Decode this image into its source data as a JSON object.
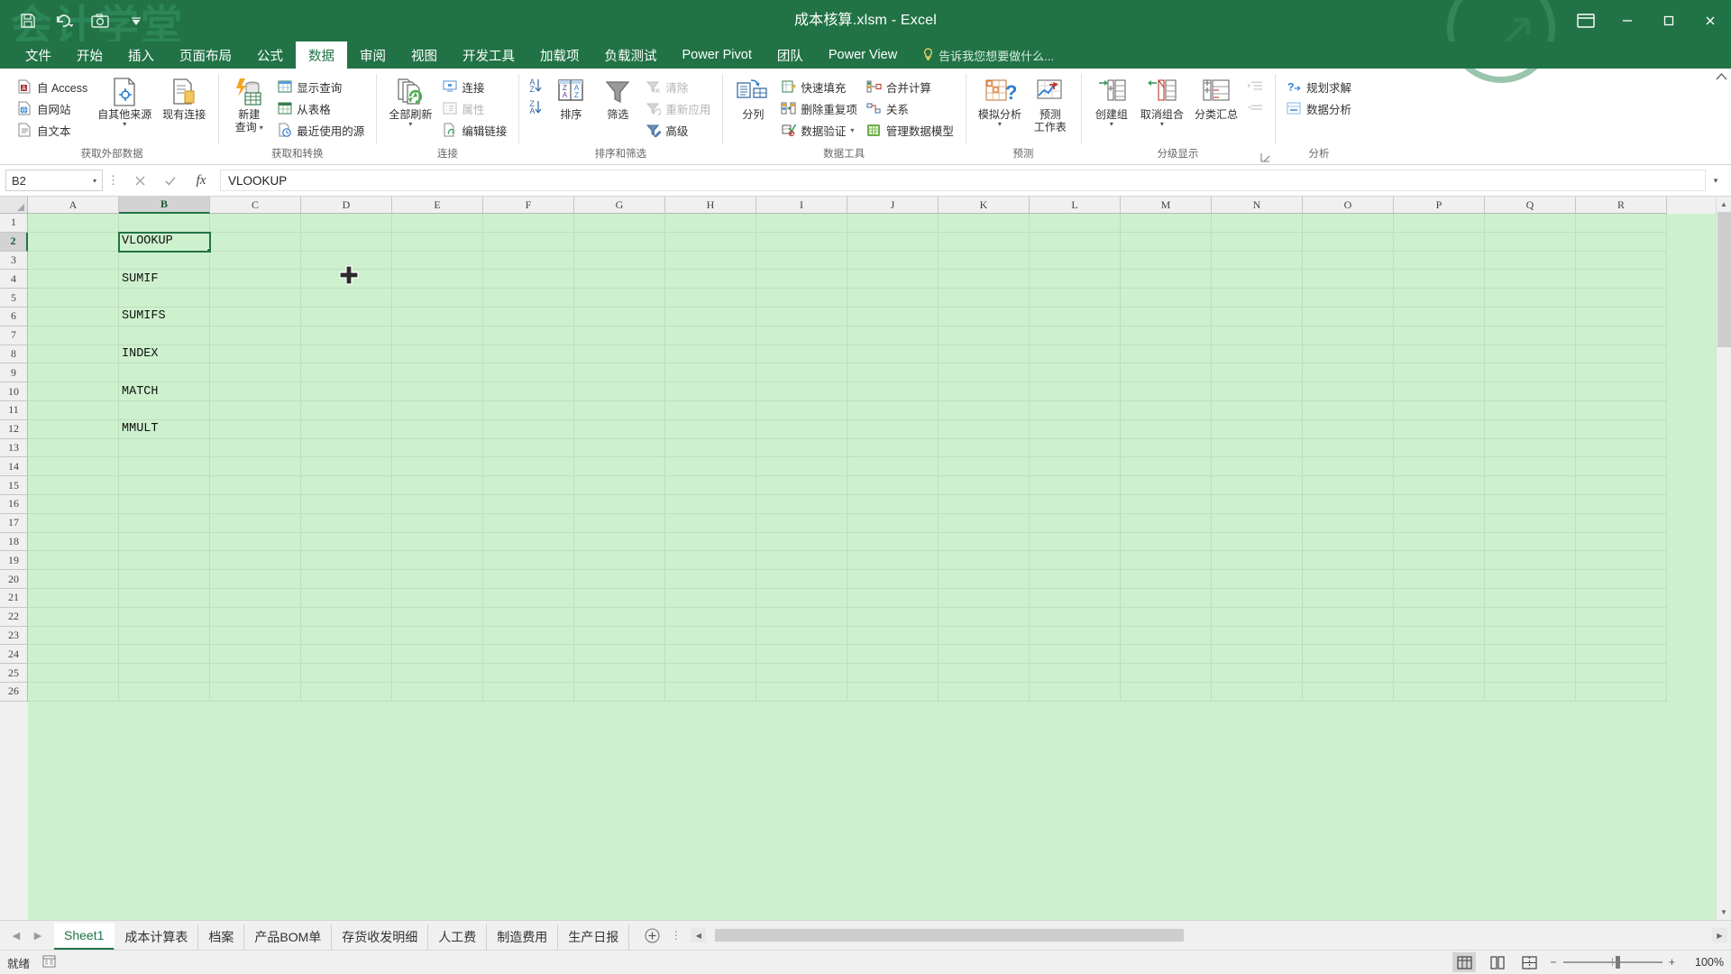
{
  "window": {
    "title": "成本核算.xlsm - Excel",
    "watermark": "会计学堂",
    "minimize": "–",
    "maximize": "□",
    "close": "✕",
    "ribbon_display_options": "ribbon-display-options"
  },
  "quick_access": [
    {
      "name": "save-icon",
      "label": "保存"
    },
    {
      "name": "undo-icon",
      "label": "撤销"
    },
    {
      "name": "screenshot-icon",
      "label": "屏幕截图"
    },
    {
      "name": "customize-qat-icon",
      "label": "自定义快速访问工具栏"
    }
  ],
  "ribbon_tabs": [
    {
      "label": "文件",
      "active": false
    },
    {
      "label": "开始",
      "active": false
    },
    {
      "label": "插入",
      "active": false
    },
    {
      "label": "页面布局",
      "active": false
    },
    {
      "label": "公式",
      "active": false
    },
    {
      "label": "数据",
      "active": true
    },
    {
      "label": "审阅",
      "active": false
    },
    {
      "label": "视图",
      "active": false
    },
    {
      "label": "开发工具",
      "active": false
    },
    {
      "label": "加载项",
      "active": false
    },
    {
      "label": "负载测试",
      "active": false
    },
    {
      "label": "Power Pivot",
      "active": false
    },
    {
      "label": "团队",
      "active": false
    },
    {
      "label": "Power View",
      "active": false
    }
  ],
  "tell_me": "告诉我您想要做什么...",
  "ribbon_groups": {
    "external_data": {
      "label": "获取外部数据",
      "small_items": [
        {
          "label": "自 Access",
          "icon": "access-icon",
          "disabled": false
        },
        {
          "label": "自网站",
          "icon": "web-icon",
          "disabled": false
        },
        {
          "label": "自文本",
          "icon": "text-file-icon",
          "disabled": false
        }
      ],
      "big_items": [
        {
          "label": "自其他来源",
          "icon": "other-sources-icon",
          "has_caret": true
        },
        {
          "label": "现有连接",
          "icon": "existing-connection-icon",
          "has_caret": false
        }
      ]
    },
    "get_transform": {
      "label": "获取和转换",
      "big_items": [
        {
          "label_line1": "新建",
          "label_line2": "查询",
          "icon": "new-query-icon",
          "has_caret": true
        }
      ],
      "small_items": [
        {
          "label": "显示查询",
          "icon": "show-queries-icon",
          "disabled": false
        },
        {
          "label": "从表格",
          "icon": "from-table-icon",
          "disabled": false
        },
        {
          "label": "最近使用的源",
          "icon": "recent-sources-icon",
          "disabled": false
        }
      ]
    },
    "connections": {
      "label": "连接",
      "big_items": [
        {
          "label": "全部刷新",
          "icon": "refresh-all-icon",
          "has_caret": true
        }
      ],
      "small_items": [
        {
          "label": "连接",
          "icon": "connections-icon",
          "disabled": false
        },
        {
          "label": "属性",
          "icon": "properties-icon",
          "disabled": true
        },
        {
          "label": "编辑链接",
          "icon": "edit-links-icon",
          "disabled": false
        }
      ]
    },
    "sort_filter": {
      "label": "排序和筛选",
      "sort_asc": "A-Z-sort-icon",
      "sort_desc": "Z-A-sort-icon",
      "big_items": [
        {
          "label": "排序",
          "icon": "sort-icon",
          "has_caret": false
        },
        {
          "label": "筛选",
          "icon": "filter-icon",
          "has_caret": false
        }
      ],
      "small_items": [
        {
          "label": "清除",
          "icon": "clear-filter-icon",
          "disabled": true
        },
        {
          "label": "重新应用",
          "icon": "reapply-filter-icon",
          "disabled": true
        },
        {
          "label": "高级",
          "icon": "advanced-filter-icon",
          "disabled": false
        }
      ]
    },
    "data_tools": {
      "label": "数据工具",
      "big_items": [
        {
          "label": "分列",
          "icon": "text-to-columns-icon",
          "has_caret": false
        }
      ],
      "small_items_col1": [
        {
          "label": "快速填充",
          "icon": "flash-fill-icon",
          "disabled": false
        },
        {
          "label": "删除重复项",
          "icon": "remove-duplicates-icon",
          "disabled": false
        },
        {
          "label": "数据验证",
          "icon": "data-validation-icon",
          "disabled": false,
          "has_caret": true
        }
      ],
      "small_items_col2": [
        {
          "label": "合并计算",
          "icon": "consolidate-icon",
          "disabled": false
        },
        {
          "label": "关系",
          "icon": "relationships-icon",
          "disabled": false
        },
        {
          "label": "管理数据模型",
          "icon": "manage-data-model-icon",
          "disabled": false
        }
      ]
    },
    "forecast": {
      "label": "预测",
      "big_items": [
        {
          "label": "模拟分析",
          "icon": "what-if-analysis-icon",
          "has_caret": true
        },
        {
          "label_line1": "预测",
          "label_line2": "工作表",
          "icon": "forecast-sheet-icon",
          "has_caret": false
        }
      ]
    },
    "outline": {
      "label": "分级显示",
      "big_items": [
        {
          "label": "创建组",
          "icon": "group-icon",
          "has_caret": true
        },
        {
          "label": "取消组合",
          "icon": "ungroup-icon",
          "has_caret": true
        },
        {
          "label": "分类汇总",
          "icon": "subtotal-icon",
          "has_caret": false
        }
      ],
      "extra_icons": [
        {
          "icon": "show-detail-icon",
          "disabled": true
        },
        {
          "icon": "hide-detail-icon",
          "disabled": true
        }
      ]
    },
    "analysis": {
      "label": "分析",
      "small_items": [
        {
          "label": "规划求解",
          "icon": "solver-icon",
          "disabled": false
        },
        {
          "label": "数据分析",
          "icon": "data-analysis-icon",
          "disabled": false
        }
      ]
    }
  },
  "formula_bar": {
    "name_box": "B2",
    "cancel_icon": "cancel-icon",
    "enter_icon": "confirm-icon",
    "fx_icon": "insert-function-icon",
    "value": "VLOOKUP",
    "expand_icon": "expand-formula-bar-icon"
  },
  "grid": {
    "columns": [
      "A",
      "B",
      "C",
      "D",
      "E",
      "F",
      "G",
      "H",
      "I",
      "J",
      "K",
      "L",
      "M",
      "N",
      "O",
      "P",
      "Q",
      "R"
    ],
    "selected_column": "B",
    "rows": [
      1,
      2,
      3,
      4,
      5,
      6,
      7,
      8,
      9,
      10,
      11,
      12,
      13,
      14,
      15,
      16,
      17,
      18,
      19,
      20,
      21,
      22,
      23,
      24,
      25,
      26
    ],
    "selected_row": 2,
    "selected_cell": "B2",
    "cell_values": {
      "B2": "VLOOKUP",
      "B4": "SUMIF",
      "B6": "SUMIFS",
      "B8": "INDEX",
      "B10": "MATCH",
      "B12": "MMULT"
    },
    "background_color": "#cdf0cd",
    "selection_color": "#217346"
  },
  "sheet_tabs": [
    {
      "label": "Sheet1",
      "active": true
    },
    {
      "label": "成本计算表",
      "active": false
    },
    {
      "label": "档案",
      "active": false
    },
    {
      "label": "产品BOM单",
      "active": false
    },
    {
      "label": "存货收发明细",
      "active": false
    },
    {
      "label": "人工费",
      "active": false
    },
    {
      "label": "制造费用",
      "active": false
    },
    {
      "label": "生产日报",
      "active": false
    }
  ],
  "sheet_nav": {
    "prev": "◀",
    "next": "▶",
    "add": "＋",
    "menu": "⋮"
  },
  "status_bar": {
    "status": "就绪",
    "macro_icon": "record-macro-icon",
    "views": [
      {
        "name": "normal-view",
        "active": true
      },
      {
        "name": "page-layout-view",
        "active": false
      },
      {
        "name": "page-break-view",
        "active": false
      }
    ],
    "zoom_out": "−",
    "zoom_in": "+",
    "zoom_level": "100%"
  }
}
